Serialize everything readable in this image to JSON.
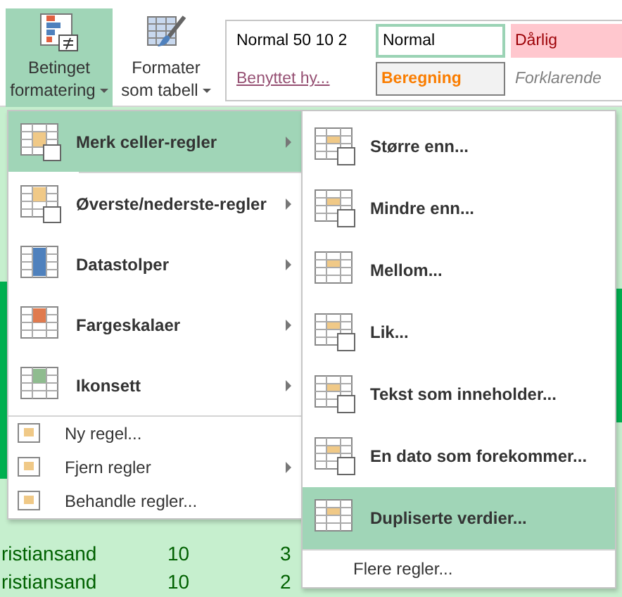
{
  "ribbon": {
    "buttons": [
      {
        "line1": "Betinget",
        "line2": "formatering",
        "selected": true
      },
      {
        "line1": "Formater",
        "line2": "som tabell",
        "selected": false
      }
    ],
    "styles": [
      {
        "text": "Normal 50 10 2",
        "kind": "plain"
      },
      {
        "text": "Normal",
        "kind": "current"
      },
      {
        "text": "Dårlig",
        "kind": "bad"
      },
      {
        "text": "Benyttet hy...",
        "kind": "link"
      },
      {
        "text": "Beregning",
        "kind": "calc"
      },
      {
        "text": "Forklarende",
        "kind": "note"
      }
    ]
  },
  "sheet": {
    "rows": [
      {
        "city": "ristiansand",
        "a": "10",
        "b": "3"
      },
      {
        "city": "ristiansand",
        "a": "10",
        "b": "2"
      }
    ]
  },
  "menu": {
    "items": [
      {
        "label": "Merk celler-regler",
        "kind": "large",
        "submenu": true,
        "selected": true
      },
      {
        "label": "Øverste/nederste-regler",
        "kind": "large",
        "submenu": true,
        "selected": false
      },
      {
        "label": "Datastolper",
        "kind": "large",
        "submenu": true,
        "selected": false
      },
      {
        "label": "Fargeskalaer",
        "kind": "large",
        "submenu": true,
        "selected": false
      },
      {
        "label": "Ikonsett",
        "kind": "large",
        "submenu": true,
        "selected": false
      },
      {
        "label": "Ny regel...",
        "kind": "small",
        "submenu": false,
        "selected": false
      },
      {
        "label": "Fjern regler",
        "kind": "small",
        "submenu": true,
        "selected": false
      },
      {
        "label": "Behandle regler...",
        "kind": "small",
        "submenu": false,
        "selected": false
      }
    ]
  },
  "submenu": {
    "items": [
      {
        "label": "Større enn...",
        "selected": false
      },
      {
        "label": "Mindre enn...",
        "selected": false
      },
      {
        "label": "Mellom...",
        "selected": false
      },
      {
        "label": "Lik...",
        "selected": false
      },
      {
        "label": "Tekst som inneholder...",
        "selected": false
      },
      {
        "label": "En dato som forekommer...",
        "selected": false
      },
      {
        "label": "Dupliserte verdier...",
        "selected": true
      }
    ],
    "footer": "Flere regler..."
  }
}
